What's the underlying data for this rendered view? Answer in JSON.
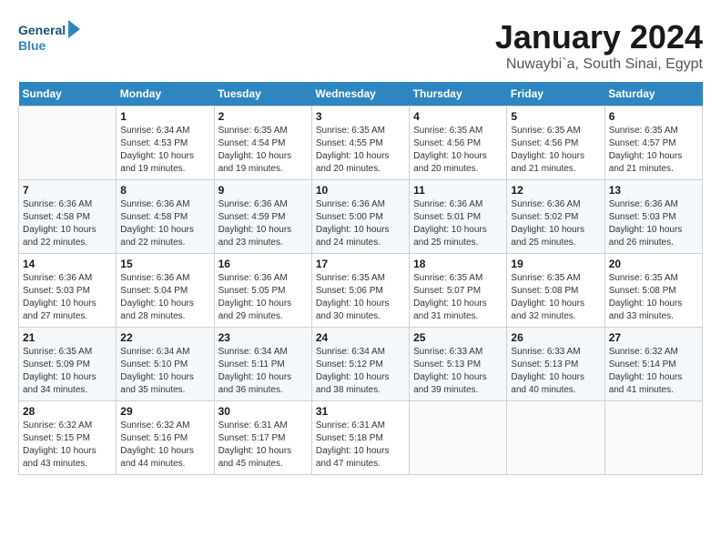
{
  "logo": {
    "line1": "General",
    "line2": "Blue"
  },
  "title": "January 2024",
  "subtitle": "Nuwaybi`a, South Sinai, Egypt",
  "weekdays": [
    "Sunday",
    "Monday",
    "Tuesday",
    "Wednesday",
    "Thursday",
    "Friday",
    "Saturday"
  ],
  "weeks": [
    [
      {
        "day": "",
        "sunrise": "",
        "sunset": "",
        "daylight": ""
      },
      {
        "day": "1",
        "sunrise": "Sunrise: 6:34 AM",
        "sunset": "Sunset: 4:53 PM",
        "daylight": "Daylight: 10 hours and 19 minutes."
      },
      {
        "day": "2",
        "sunrise": "Sunrise: 6:35 AM",
        "sunset": "Sunset: 4:54 PM",
        "daylight": "Daylight: 10 hours and 19 minutes."
      },
      {
        "day": "3",
        "sunrise": "Sunrise: 6:35 AM",
        "sunset": "Sunset: 4:55 PM",
        "daylight": "Daylight: 10 hours and 20 minutes."
      },
      {
        "day": "4",
        "sunrise": "Sunrise: 6:35 AM",
        "sunset": "Sunset: 4:56 PM",
        "daylight": "Daylight: 10 hours and 20 minutes."
      },
      {
        "day": "5",
        "sunrise": "Sunrise: 6:35 AM",
        "sunset": "Sunset: 4:56 PM",
        "daylight": "Daylight: 10 hours and 21 minutes."
      },
      {
        "day": "6",
        "sunrise": "Sunrise: 6:35 AM",
        "sunset": "Sunset: 4:57 PM",
        "daylight": "Daylight: 10 hours and 21 minutes."
      }
    ],
    [
      {
        "day": "7",
        "sunrise": "Sunrise: 6:36 AM",
        "sunset": "Sunset: 4:58 PM",
        "daylight": "Daylight: 10 hours and 22 minutes."
      },
      {
        "day": "8",
        "sunrise": "Sunrise: 6:36 AM",
        "sunset": "Sunset: 4:58 PM",
        "daylight": "Daylight: 10 hours and 22 minutes."
      },
      {
        "day": "9",
        "sunrise": "Sunrise: 6:36 AM",
        "sunset": "Sunset: 4:59 PM",
        "daylight": "Daylight: 10 hours and 23 minutes."
      },
      {
        "day": "10",
        "sunrise": "Sunrise: 6:36 AM",
        "sunset": "Sunset: 5:00 PM",
        "daylight": "Daylight: 10 hours and 24 minutes."
      },
      {
        "day": "11",
        "sunrise": "Sunrise: 6:36 AM",
        "sunset": "Sunset: 5:01 PM",
        "daylight": "Daylight: 10 hours and 25 minutes."
      },
      {
        "day": "12",
        "sunrise": "Sunrise: 6:36 AM",
        "sunset": "Sunset: 5:02 PM",
        "daylight": "Daylight: 10 hours and 25 minutes."
      },
      {
        "day": "13",
        "sunrise": "Sunrise: 6:36 AM",
        "sunset": "Sunset: 5:03 PM",
        "daylight": "Daylight: 10 hours and 26 minutes."
      }
    ],
    [
      {
        "day": "14",
        "sunrise": "Sunrise: 6:36 AM",
        "sunset": "Sunset: 5:03 PM",
        "daylight": "Daylight: 10 hours and 27 minutes."
      },
      {
        "day": "15",
        "sunrise": "Sunrise: 6:36 AM",
        "sunset": "Sunset: 5:04 PM",
        "daylight": "Daylight: 10 hours and 28 minutes."
      },
      {
        "day": "16",
        "sunrise": "Sunrise: 6:36 AM",
        "sunset": "Sunset: 5:05 PM",
        "daylight": "Daylight: 10 hours and 29 minutes."
      },
      {
        "day": "17",
        "sunrise": "Sunrise: 6:35 AM",
        "sunset": "Sunset: 5:06 PM",
        "daylight": "Daylight: 10 hours and 30 minutes."
      },
      {
        "day": "18",
        "sunrise": "Sunrise: 6:35 AM",
        "sunset": "Sunset: 5:07 PM",
        "daylight": "Daylight: 10 hours and 31 minutes."
      },
      {
        "day": "19",
        "sunrise": "Sunrise: 6:35 AM",
        "sunset": "Sunset: 5:08 PM",
        "daylight": "Daylight: 10 hours and 32 minutes."
      },
      {
        "day": "20",
        "sunrise": "Sunrise: 6:35 AM",
        "sunset": "Sunset: 5:08 PM",
        "daylight": "Daylight: 10 hours and 33 minutes."
      }
    ],
    [
      {
        "day": "21",
        "sunrise": "Sunrise: 6:35 AM",
        "sunset": "Sunset: 5:09 PM",
        "daylight": "Daylight: 10 hours and 34 minutes."
      },
      {
        "day": "22",
        "sunrise": "Sunrise: 6:34 AM",
        "sunset": "Sunset: 5:10 PM",
        "daylight": "Daylight: 10 hours and 35 minutes."
      },
      {
        "day": "23",
        "sunrise": "Sunrise: 6:34 AM",
        "sunset": "Sunset: 5:11 PM",
        "daylight": "Daylight: 10 hours and 36 minutes."
      },
      {
        "day": "24",
        "sunrise": "Sunrise: 6:34 AM",
        "sunset": "Sunset: 5:12 PM",
        "daylight": "Daylight: 10 hours and 38 minutes."
      },
      {
        "day": "25",
        "sunrise": "Sunrise: 6:33 AM",
        "sunset": "Sunset: 5:13 PM",
        "daylight": "Daylight: 10 hours and 39 minutes."
      },
      {
        "day": "26",
        "sunrise": "Sunrise: 6:33 AM",
        "sunset": "Sunset: 5:13 PM",
        "daylight": "Daylight: 10 hours and 40 minutes."
      },
      {
        "day": "27",
        "sunrise": "Sunrise: 6:32 AM",
        "sunset": "Sunset: 5:14 PM",
        "daylight": "Daylight: 10 hours and 41 minutes."
      }
    ],
    [
      {
        "day": "28",
        "sunrise": "Sunrise: 6:32 AM",
        "sunset": "Sunset: 5:15 PM",
        "daylight": "Daylight: 10 hours and 43 minutes."
      },
      {
        "day": "29",
        "sunrise": "Sunrise: 6:32 AM",
        "sunset": "Sunset: 5:16 PM",
        "daylight": "Daylight: 10 hours and 44 minutes."
      },
      {
        "day": "30",
        "sunrise": "Sunrise: 6:31 AM",
        "sunset": "Sunset: 5:17 PM",
        "daylight": "Daylight: 10 hours and 45 minutes."
      },
      {
        "day": "31",
        "sunrise": "Sunrise: 6:31 AM",
        "sunset": "Sunset: 5:18 PM",
        "daylight": "Daylight: 10 hours and 47 minutes."
      },
      {
        "day": "",
        "sunrise": "",
        "sunset": "",
        "daylight": ""
      },
      {
        "day": "",
        "sunrise": "",
        "sunset": "",
        "daylight": ""
      },
      {
        "day": "",
        "sunrise": "",
        "sunset": "",
        "daylight": ""
      }
    ]
  ]
}
